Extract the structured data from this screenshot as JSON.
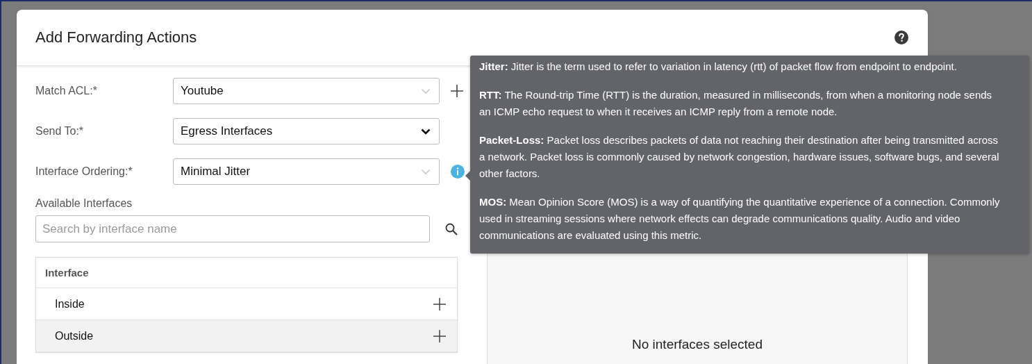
{
  "dialog": {
    "title": "Add Forwarding Actions"
  },
  "fields": [
    {
      "label": "Match ACL:*",
      "value": "Youtube",
      "active": false,
      "kind": "add"
    },
    {
      "label": "Send To:*",
      "value": "Egress Interfaces",
      "active": true,
      "kind": "plain"
    },
    {
      "label": "Interface Ordering:*",
      "value": "Minimal Jitter",
      "active": false,
      "kind": "info"
    }
  ],
  "tooltip": {
    "paragraphs": [
      "**Jitter:** Jitter is the term used to refer to variation in latency (rtt) of packet flow from endpoint to endpoint.",
      "**RTT:** The Round-trip Time (RTT) is the duration, measured in milliseconds, from when a monitoring node sends an ICMP echo request to when it receives an ICMP reply from a remote node.",
      "**Packet-Loss:** Packet loss describes packets of data not reaching their destination after being transmitted across a network. Packet loss is commonly caused by network congestion, hardware issues, software bugs, and several other factors.",
      "**MOS:** Mean Opinion Score (MOS) is a way of quantifying the quantitative experience of a connection. Commonly used in streaming sessions where network effects can degrade communications quality. Audio and video communications are evaluated using this metric."
    ]
  },
  "available": {
    "heading": "Available Interfaces",
    "search": {
      "placeholder": "Search by interface name"
    },
    "table": {
      "columns": [
        "Interface"
      ],
      "rows": [
        {
          "name": "Inside",
          "highlighted": false
        },
        {
          "name": "Outside",
          "highlighted": true
        }
      ]
    }
  },
  "selected_panel": {
    "empty_text": "No interfaces selected"
  }
}
